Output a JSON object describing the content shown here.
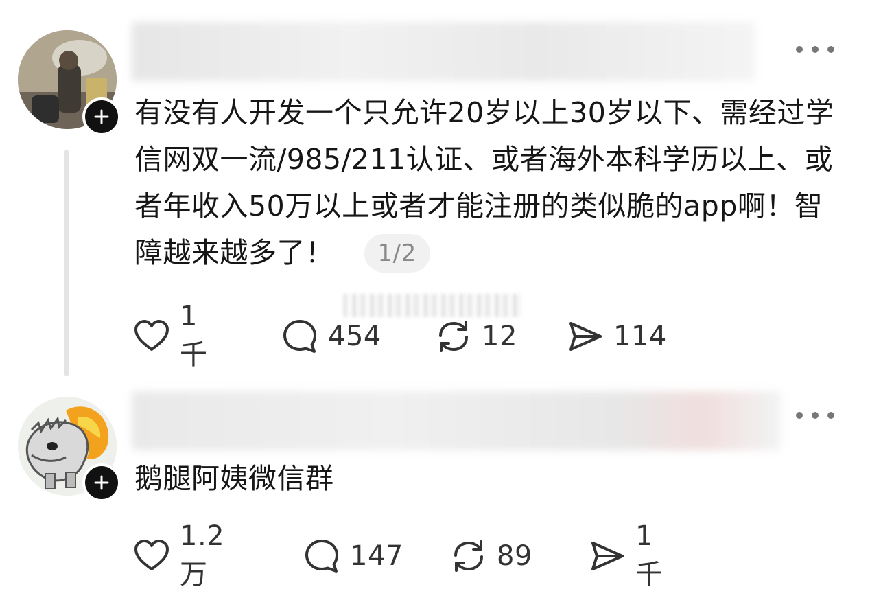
{
  "posts": [
    {
      "body": "有没有人开发一个只允许20岁以上30岁以下、需经过学信网双一流/985/211认证、或者海外本科学历以上、或者年收入50万以上或者才能注册的类似脆的app啊！智障越来越多了！",
      "page_indicator": "1/2",
      "actions": {
        "like": {
          "count": "1千",
          "icon": "heart-icon"
        },
        "reply": {
          "count": "454",
          "icon": "comment-bubble-icon"
        },
        "repost": {
          "count": "12",
          "icon": "repost-icon"
        },
        "share": {
          "count": "114",
          "icon": "send-icon"
        }
      }
    },
    {
      "body": "鹅腿阿姨微信群",
      "actions": {
        "like": {
          "count": "1.2万",
          "icon": "heart-icon"
        },
        "reply": {
          "count": "147",
          "icon": "comment-bubble-icon"
        },
        "repost": {
          "count": "89",
          "icon": "repost-icon"
        },
        "share": {
          "count": "1千",
          "icon": "send-icon"
        }
      }
    }
  ],
  "colors": {
    "text": "#161616",
    "icon": "#333333",
    "muted": "#888888",
    "badge": "#111111",
    "thread_line": "#e4e4e4"
  }
}
